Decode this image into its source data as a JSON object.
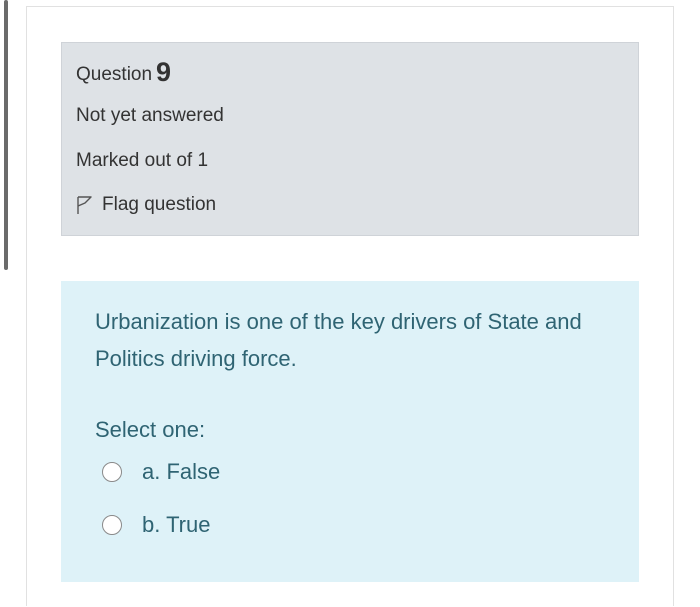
{
  "question": {
    "label": "Question",
    "number": "9",
    "state": "Not yet answered",
    "grade": "Marked out of 1",
    "flag_label": "Flag question"
  },
  "content": {
    "text": "Urbanization is one of the key drivers of State and Politics driving force.",
    "prompt": "Select one:",
    "options": [
      {
        "label": "a. False",
        "selected": false
      },
      {
        "label": "b. True",
        "selected": false
      }
    ]
  },
  "icons": {
    "flag": "flag-outline-icon",
    "radio": "radio-unchecked-icon"
  },
  "colors": {
    "info_bg": "#dee2e6",
    "content_bg": "#def2f8",
    "content_text": "#2f6473",
    "info_text": "#333333"
  }
}
